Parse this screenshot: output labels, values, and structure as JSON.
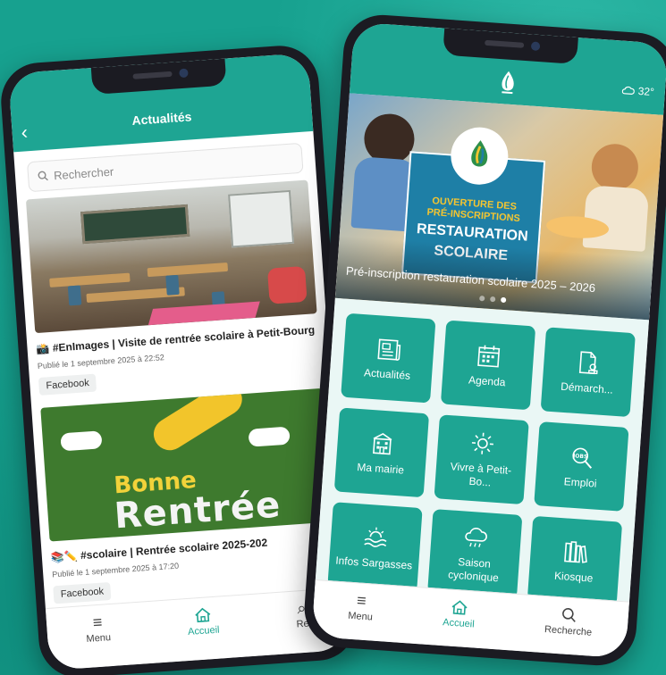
{
  "left_phone": {
    "header_title": "Actualités",
    "search_placeholder": "Rechercher",
    "posts": [
      {
        "title": "📸 #EnImages | Visite de rentrée scolaire à Petit-Bourg",
        "date": "Publié le 1 septembre 2025 à 22:52",
        "source": "Facebook"
      },
      {
        "title": "📚✏️ #scolaire | Rentrée scolaire 2025-202",
        "date": "Publié le 1 septembre 2025 à 17:20",
        "source": "Facebook",
        "image_text_line1": "Bonne",
        "image_text_line2": "Rentrée"
      }
    ],
    "tabbar": [
      {
        "label": "Menu",
        "icon": "menu-icon"
      },
      {
        "label": "Accueil",
        "icon": "home-icon"
      },
      {
        "label": "Re",
        "icon": "search-icon"
      }
    ]
  },
  "right_phone": {
    "weather": "32°",
    "banner": {
      "poster_line1": "OUVERTURE DES",
      "poster_line2": "PRÉ-INSCRIPTIONS",
      "poster_line3": "RESTAURATION",
      "poster_line4": "SCOLAIRE",
      "caption": "Pré-inscription restauration scolaire 2025 – 2026",
      "slides": 3,
      "active_slide": 3
    },
    "tiles": [
      {
        "label": "Actualités",
        "icon": "newspaper-icon"
      },
      {
        "label": "Agenda",
        "icon": "calendar-icon"
      },
      {
        "label": "Démarch...",
        "icon": "document-stamp-icon"
      },
      {
        "label": "Ma mairie",
        "icon": "town-hall-icon"
      },
      {
        "label": "Vivre à Petit-Bo...",
        "icon": "sun-icon"
      },
      {
        "label": "Emploi",
        "icon": "job-search-icon"
      },
      {
        "label": "Infos Sargasses",
        "icon": "sea-sun-icon"
      },
      {
        "label": "Saison cyclonique",
        "icon": "storm-cloud-icon"
      },
      {
        "label": "Kiosque",
        "icon": "books-icon"
      }
    ],
    "tabbar": [
      {
        "label": "Menu",
        "icon": "menu-icon"
      },
      {
        "label": "Accueil",
        "icon": "home-icon"
      },
      {
        "label": "Recherche",
        "icon": "search-icon"
      }
    ]
  },
  "colors": {
    "background": "#17a18f",
    "accent": "#1ea593",
    "tile_area": "#eaf7f5"
  }
}
